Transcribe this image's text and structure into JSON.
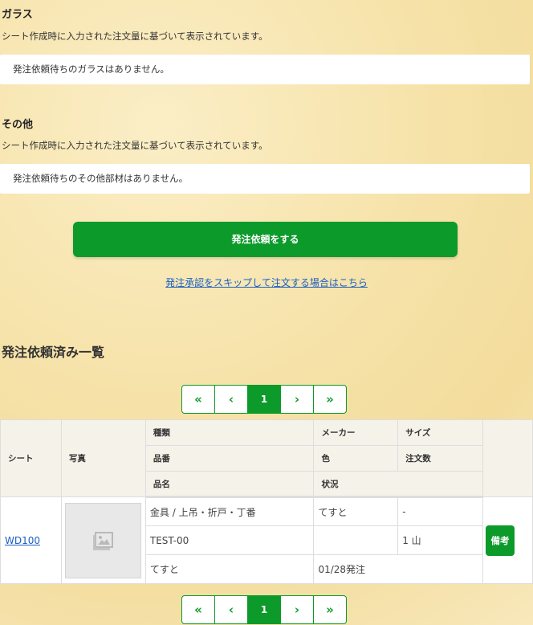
{
  "glass": {
    "title": "ガラス",
    "desc": "シート作成時に入力された注文量に基づいて表示されています。",
    "notice": "発注依頼待ちのガラスはありません。"
  },
  "other": {
    "title": "その他",
    "desc": "シート作成時に入力された注文量に基づいて表示されています。",
    "notice": "発注依頼待ちのその他部材はありません。"
  },
  "actions": {
    "order_request": "発注依頼をする",
    "skip_link": "発注承認をスキップして注文する場合はこちら"
  },
  "history": {
    "title": "発注依頼済み一覧"
  },
  "pagination": {
    "first": "«",
    "prev": "‹",
    "current": "1",
    "next": "›",
    "last": "»"
  },
  "table": {
    "headers": {
      "sheet": "シート",
      "photo": "写真",
      "type": "種類",
      "maker": "メーカー",
      "size": "サイズ",
      "part_no": "品番",
      "color": "色",
      "qty": "注文数",
      "name": "品名",
      "status": "状況"
    },
    "rows": [
      {
        "sheet": "WD100",
        "type": "金具 / 上吊・折戸・丁番",
        "maker": "てすと",
        "size": "-",
        "part_no": "TEST-00",
        "color": "",
        "qty": "1 山",
        "name": "てすと",
        "status": "01/28発注",
        "note_button": "備考",
        "photo_icon": "image-placeholder-icon"
      }
    ]
  },
  "colors": {
    "accent": "#0c9a2a",
    "link": "#1a5fc2"
  }
}
